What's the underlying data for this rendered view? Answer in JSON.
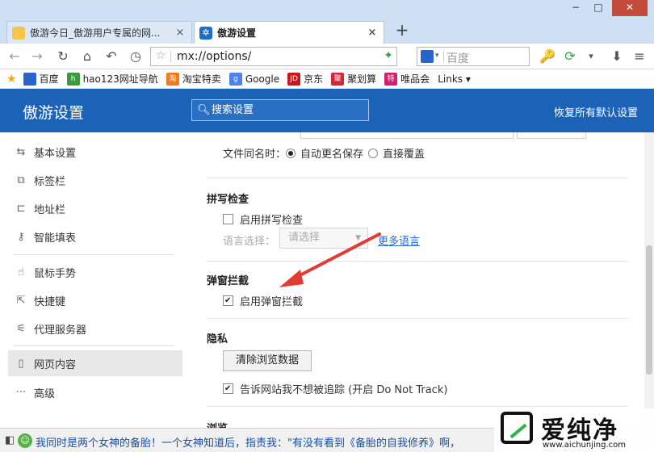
{
  "window": {
    "controls": {
      "minimize": "−",
      "maximize": "□",
      "close": "✕"
    }
  },
  "tabs": [
    {
      "title": "傲游今日_傲游用户专属的网...",
      "close": "×"
    },
    {
      "title": "傲游设置",
      "close": "×"
    }
  ],
  "new_tab": "+",
  "nav": {
    "back": "←",
    "forward": "→",
    "refresh": "↻",
    "home": "⌂",
    "undo": "↶",
    "history": "◷",
    "address": "mx://options/",
    "search_placeholder": "百度",
    "right_icons": [
      "🔑",
      "⟳",
      "▾",
      "⬇",
      "≡"
    ]
  },
  "bookmarks": [
    {
      "label": "百度",
      "icon": "baidu-icon",
      "color": "#2c63c9",
      "glyph": "🐾"
    },
    {
      "label": "hao123网址导航",
      "icon": "hao123-icon",
      "color": "#3c9a3c",
      "glyph": "h"
    },
    {
      "label": "淘宝特卖",
      "icon": "taobao-icon",
      "color": "#f07a1a",
      "glyph": "淘"
    },
    {
      "label": "Google",
      "icon": "google-icon",
      "color": "#4a86e8",
      "glyph": "g"
    },
    {
      "label": "京东",
      "icon": "jd-icon",
      "color": "#c8161d",
      "glyph": "JD"
    },
    {
      "label": "聚划算",
      "icon": "juhuasuan-icon",
      "color": "#d1283a",
      "glyph": "聚"
    },
    {
      "label": "唯品会",
      "icon": "vip-icon",
      "color": "#d0226e",
      "glyph": "特"
    },
    {
      "label": "Links ▾",
      "icon": "",
      "color": "",
      "glyph": ""
    }
  ],
  "header": {
    "title": "傲游设置",
    "search_placeholder": "搜索设置",
    "reset": "恢复所有默认设置"
  },
  "sidebar": {
    "items": [
      {
        "label": "基本设置",
        "icon": "sliders-icon",
        "glyph": "⇆"
      },
      {
        "label": "标签栏",
        "icon": "tab-icon",
        "glyph": "⧉"
      },
      {
        "label": "地址栏",
        "icon": "address-bar-icon",
        "glyph": "⊏"
      },
      {
        "label": "智能填表",
        "icon": "key-icon",
        "glyph": "⚷"
      },
      {
        "label": "鼠标手势",
        "icon": "mouse-gesture-icon",
        "glyph": "☝"
      },
      {
        "label": "快捷键",
        "icon": "shortcut-icon",
        "glyph": "⇱"
      },
      {
        "label": "代理服务器",
        "icon": "proxy-icon",
        "glyph": "⚟"
      },
      {
        "label": "网页内容",
        "icon": "page-icon",
        "glyph": "▯"
      },
      {
        "label": "高级",
        "icon": "more-icon",
        "glyph": "···"
      }
    ]
  },
  "content": {
    "file_same_name": {
      "label": "文件同名时：",
      "option_auto": "自动更名保存",
      "option_overwrite": "直接覆盖",
      "selected": "auto"
    },
    "spellcheck": {
      "title": "拼写检查",
      "enable_label": "启用拼写检查",
      "enabled": false,
      "language_label": "语言选择：",
      "language_value": "请选择",
      "more_languages": "更多语言"
    },
    "popup_block": {
      "title": "弹窗拦截",
      "enable_label": "启用弹窗拦截",
      "enabled": true
    },
    "privacy": {
      "title": "隐私",
      "clear_button": "清除浏览数据",
      "dnt_label": "告诉网站我不想被追踪 (开启 Do Not Track)",
      "dnt_enabled": true
    },
    "next_title": "浏览"
  },
  "statusbar": {
    "news": "我同时是两个女神的备胎！一个女神知道后，指责我：\"有没有看到《备胎的自我修养》啊，"
  },
  "watermark": {
    "brand": "爱纯净",
    "domain": "www.aichunjing.com"
  },
  "colors": {
    "accent": "#1c63b7",
    "arrow": "#e23a35",
    "link": "#2b6cc4"
  }
}
